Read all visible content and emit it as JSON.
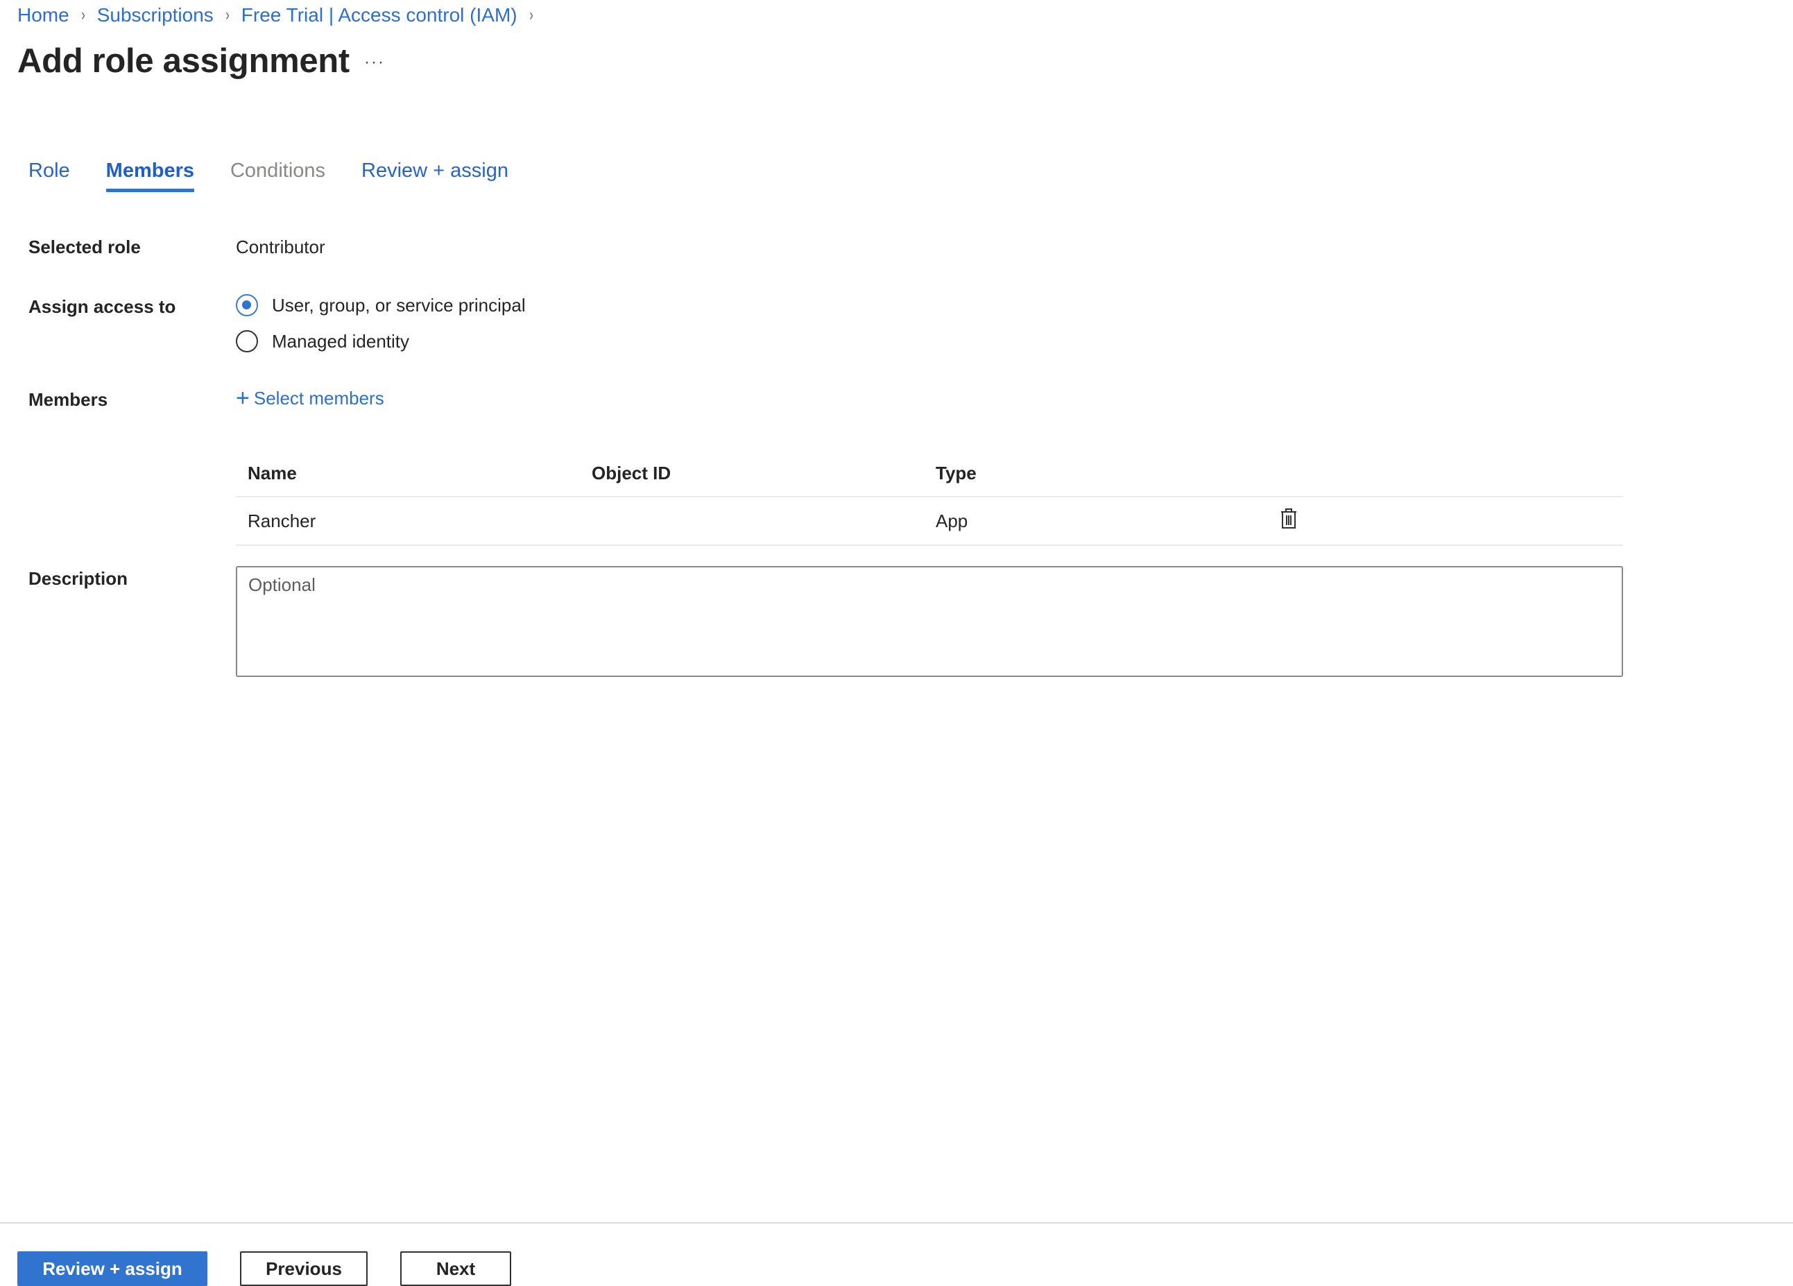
{
  "breadcrumb": {
    "items": [
      "Home",
      "Subscriptions",
      "Free Trial | Access control (IAM)"
    ],
    "separator": "›"
  },
  "header": {
    "title": "Add role assignment",
    "more_label": "···"
  },
  "tabs": [
    {
      "label": "Role",
      "state": "enabled"
    },
    {
      "label": "Members",
      "state": "active"
    },
    {
      "label": "Conditions",
      "state": "disabled"
    },
    {
      "label": "Review + assign",
      "state": "enabled"
    }
  ],
  "form": {
    "selected_role": {
      "label": "Selected role",
      "value": "Contributor"
    },
    "assign_access": {
      "label": "Assign access to",
      "options": [
        {
          "label": "User, group, or service principal",
          "checked": true
        },
        {
          "label": "Managed identity",
          "checked": false
        }
      ]
    },
    "members": {
      "label": "Members",
      "select_label": "Select members",
      "table": {
        "columns": [
          "Name",
          "Object ID",
          "Type"
        ],
        "rows": [
          {
            "name": "Rancher",
            "object_id": "",
            "type": "App",
            "action_icon": "trash-icon"
          }
        ]
      }
    },
    "description": {
      "label": "Description",
      "value": "",
      "placeholder": "Optional"
    }
  },
  "footer": {
    "review_assign_label": "Review + assign",
    "previous_label": "Previous",
    "next_label": "Next"
  },
  "colors": {
    "accent": "#3174d0",
    "link": "#2a6fd1",
    "disabled_text": "#8a8886"
  }
}
